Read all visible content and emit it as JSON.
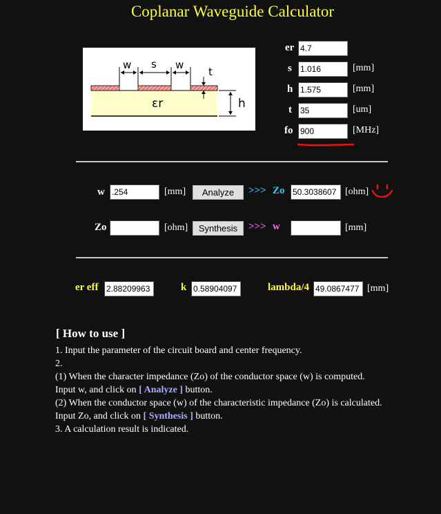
{
  "title": "Coplanar Waveguide Calculator",
  "diagram": {
    "labels": {
      "w1": "w",
      "s": "s",
      "w2": "w",
      "t": "t",
      "er": "εr",
      "h": "h"
    }
  },
  "params": {
    "er": {
      "label": "er",
      "value": "4.7",
      "unit": ""
    },
    "s": {
      "label": "s",
      "value": "1.016",
      "unit": "[mm]"
    },
    "h": {
      "label": "h",
      "value": "1.575",
      "unit": "[mm]"
    },
    "t": {
      "label": "t",
      "value": "35",
      "unit": "[um]"
    },
    "fo": {
      "label": "fo",
      "value": "900",
      "unit": "[MHz]"
    }
  },
  "analyze": {
    "w_label": "w",
    "w_value": ".254",
    "w_unit": "[mm]",
    "button": "Analyze",
    "arrow": ">>>",
    "out_label": "Zo",
    "out_value": "50.3038607",
    "out_unit": "[ohm]"
  },
  "synthesis": {
    "zo_label": "Zo",
    "zo_value": "",
    "zo_unit": "[ohm]",
    "button": "Synthesis",
    "arrow": ">>>",
    "out_label": "w",
    "out_value": "",
    "out_unit": "[mm]"
  },
  "results": {
    "ereff_label": "er eff",
    "ereff_value": "2.88209963",
    "k_label": "k",
    "k_value": "0.58904097",
    "lambda_label": "lambda/4",
    "lambda_value": "49.0867477",
    "lambda_unit": "[mm]"
  },
  "howto": {
    "heading": "[ How to use ]",
    "line1": "1. Input the parameter of the circuit board and center frequency.",
    "line2": "2.",
    "line3": "(1) When the character impedance (Zo) of the conductor space (w) is computed.",
    "line4_pre": "Input w, and click on ",
    "line4_hl": "[ Analyze ]",
    "line4_post": " button.",
    "line5": "(2) When the conductor space (w) of the characteristic impedance (Zo) is calculated.",
    "line6_pre": "Input Zo, and click on ",
    "line6_hl": "[ Synthesis ]",
    "line6_post": " button.",
    "line7": "3. A calculation result is indicated."
  },
  "colors": {
    "background": "#111111",
    "title": "#ffff33",
    "arrow_analyze": "#33ccff",
    "arrow_synthesis": "#ff66ff",
    "annotation": "#ee1111",
    "highlight": "#aaaaff"
  }
}
